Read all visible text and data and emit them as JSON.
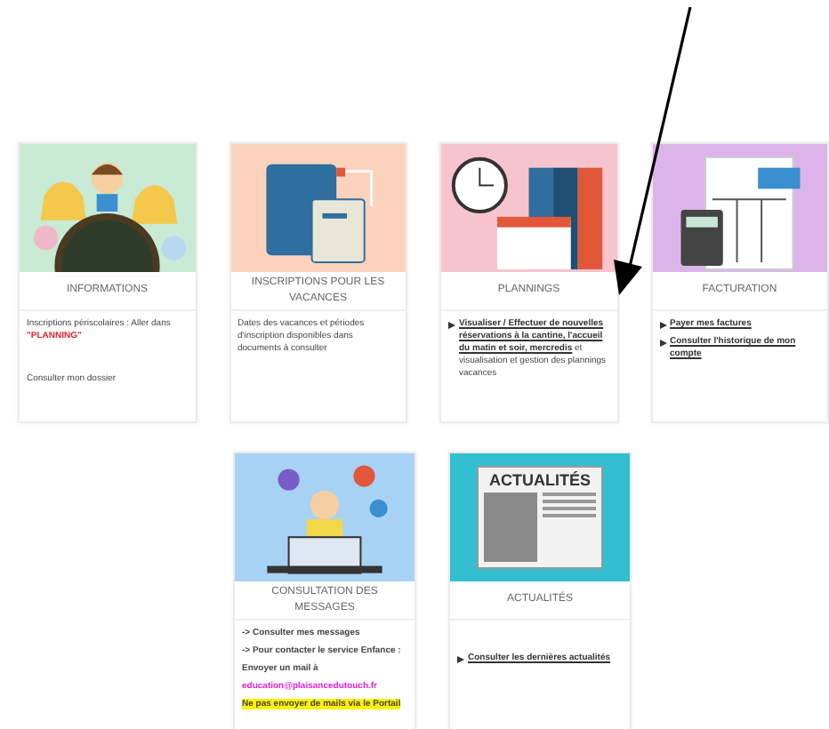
{
  "cards": [
    {
      "kind": "kids",
      "title": "INFORMATIONS",
      "paragraphs": [
        {
          "kind": "plain",
          "parts": [
            {
              "text": "Inscriptions périscolaires : Aller dans ",
              "kind": "plain"
            },
            {
              "text": "\"PLANNING\"",
              "kind": "red"
            }
          ]
        },
        {
          "kind": "spacer_plain",
          "parts": [
            {
              "text": "Consulter mon dossier",
              "kind": "plain"
            }
          ]
        }
      ]
    },
    {
      "kind": "notebook",
      "title": "INSCRIPTIONS POUR LES VACANCES",
      "paragraphs": [
        {
          "kind": "plain",
          "parts": [
            {
              "text": "Dates des vacances et périodes d'inscription disponibles dans documents à consulter",
              "kind": "plain"
            }
          ]
        }
      ]
    },
    {
      "kind": "planning",
      "title": "PLANNINGS",
      "paragraphs": [
        {
          "kind": "bullet",
          "parts": [
            {
              "text": "Visualiser / Effectuer de nouvelles réservations à la cantine, l'accueil du matin et soir, mercredis",
              "kind": "link"
            },
            {
              "text": " et visualisation et gestion des plannings vacances",
              "kind": "plain"
            }
          ]
        }
      ]
    },
    {
      "kind": "invoice",
      "title": "FACTURATION",
      "paragraphs": [
        {
          "kind": "bullet",
          "parts": [
            {
              "text": "Payer mes factures",
              "kind": "link"
            }
          ]
        },
        {
          "kind": "bullet",
          "parts": [
            {
              "text": "Consulter l'historique de mon compte",
              "kind": "link"
            }
          ]
        }
      ]
    },
    {
      "kind": "messages",
      "title": "CONSULTATION DES MESSAGES",
      "paragraphs": [
        {
          "kind": "plain",
          "parts": [
            {
              "text": "-> Consulter mes messages",
              "kind": "bold"
            }
          ]
        },
        {
          "kind": "plain",
          "parts": [
            {
              "text": "-> Pour contacter le service Enfance :",
              "kind": "bold"
            }
          ]
        },
        {
          "kind": "plain",
          "parts": [
            {
              "text": "Envoyer un mail à",
              "kind": "bold"
            }
          ]
        },
        {
          "kind": "plain",
          "parts": [
            {
              "text": "education@plaisancedutouch.fr",
              "kind": "magenta"
            }
          ]
        },
        {
          "kind": "plain",
          "parts": [
            {
              "text": "Ne pas envoyer de mails via le Portail",
              "kind": "highlight"
            }
          ]
        }
      ]
    },
    {
      "kind": "news",
      "image_caption": "ACTUALITÉS",
      "title": "ACTUALITÉS",
      "paragraphs": [
        {
          "kind": "spacer_bullet",
          "parts": [
            {
              "text": "Consulter les dernières actualités",
              "kind": "link"
            }
          ]
        }
      ]
    }
  ]
}
